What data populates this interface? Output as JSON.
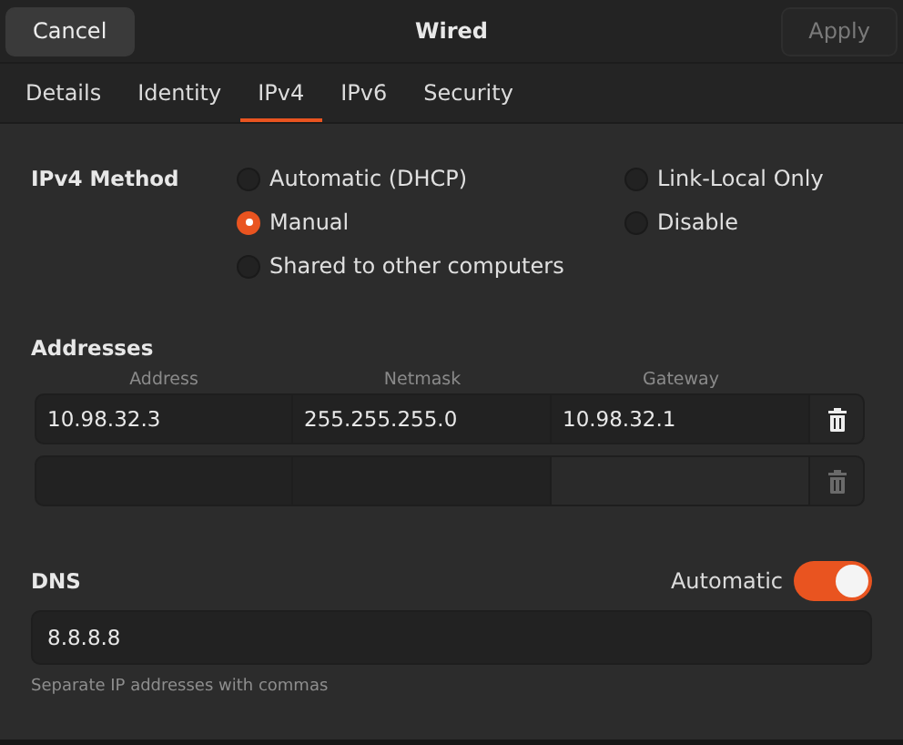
{
  "header": {
    "cancel": "Cancel",
    "title": "Wired",
    "apply": "Apply",
    "apply_disabled": true
  },
  "tabs": [
    {
      "label": "Details",
      "selected": false
    },
    {
      "label": "Identity",
      "selected": false
    },
    {
      "label": "IPv4",
      "selected": true
    },
    {
      "label": "IPv6",
      "selected": false
    },
    {
      "label": "Security",
      "selected": false
    }
  ],
  "method": {
    "label": "IPv4 Method",
    "options": [
      {
        "label": "Automatic (DHCP)",
        "selected": false
      },
      {
        "label": "Manual",
        "selected": true
      },
      {
        "label": "Shared to other computers",
        "selected": false
      },
      {
        "label": "Link-Local Only",
        "selected": false
      },
      {
        "label": "Disable",
        "selected": false
      }
    ]
  },
  "addresses": {
    "label": "Addresses",
    "columns": [
      "Address",
      "Netmask",
      "Gateway"
    ],
    "rows": [
      {
        "cells": [
          "10.98.32.3",
          "255.255.255.0",
          "10.98.32.1"
        ],
        "delete_disabled": false
      },
      {
        "cells": [
          "",
          "",
          ""
        ],
        "delete_disabled": true
      }
    ]
  },
  "dns": {
    "label": "DNS",
    "auto_label": "Automatic",
    "automatic": true,
    "value": "8.8.8.8",
    "hint": "Separate IP addresses with commas"
  }
}
